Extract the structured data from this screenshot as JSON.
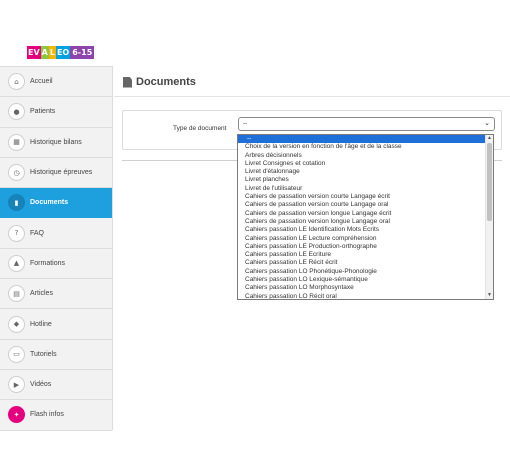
{
  "logo": {
    "p1": "EV",
    "p2": "A",
    "p3": "L",
    "p4": "EO",
    "p5": "6-15"
  },
  "sidebar": {
    "items": [
      {
        "label": "Accueil",
        "icon": "home-icon",
        "glyph": "⌂"
      },
      {
        "label": "Patients",
        "icon": "user-icon",
        "glyph": "●"
      },
      {
        "label": "Historique bilans",
        "icon": "calculator-icon",
        "glyph": "▦"
      },
      {
        "label": "Historique épreuves",
        "icon": "clock-icon",
        "glyph": "◷"
      },
      {
        "label": "Documents",
        "icon": "file-icon",
        "glyph": "▮"
      },
      {
        "label": "FAQ",
        "icon": "question-icon",
        "glyph": "?"
      },
      {
        "label": "Formations",
        "icon": "graduation-cap-icon",
        "glyph": "▲"
      },
      {
        "label": "Articles",
        "icon": "newspaper-icon",
        "glyph": "▤"
      },
      {
        "label": "Hotline",
        "icon": "chat-icon",
        "glyph": "◆"
      },
      {
        "label": "Tutoriels",
        "icon": "monitor-icon",
        "glyph": "▭"
      },
      {
        "label": "Vidéos",
        "icon": "video-camera-icon",
        "glyph": "▶"
      },
      {
        "label": "Flash infos",
        "icon": "lightbulb-icon",
        "glyph": "✦"
      }
    ],
    "active_index": 4
  },
  "main": {
    "title": "Documents",
    "field_label": "Type de document",
    "select_value": "--",
    "select_arrow": "⌄"
  },
  "dropdown": {
    "options": [
      "--",
      "Choix de la version en fonction de l'âge et de la classe",
      "Arbres décisionnels",
      "Livret Consignes et cotation",
      "Livret d'étalonnage",
      "Livret planches",
      "Livret de l'utilisateur",
      "Cahiers de passation version courte Langage écrit",
      "Cahiers de passation version courte Langage oral",
      "Cahiers de passation version longue Langage écrit",
      "Cahiers de passation version longue Langage oral",
      "Cahiers passation LE Identification Mots Ecrits",
      "Cahiers passation LE Lecture compréhension",
      "Cahiers passation LE Production-orthographe",
      "Cahiers passation LE Ecriture",
      "Cahiers passation LE Récit écrit",
      "Cahiers passation LO Phonétique-Phonologie",
      "Cahiers passation LO Lexique-sémantique",
      "Cahiers passation LO Morphosyntaxe",
      "Cahiers passation LO Récit oral"
    ],
    "selected_index": 0,
    "scroll_up": "▲",
    "scroll_down": "▼"
  },
  "colors": {
    "accent": "#1e9fde",
    "selection": "#1e6fd8",
    "pink": "#e6007e"
  }
}
